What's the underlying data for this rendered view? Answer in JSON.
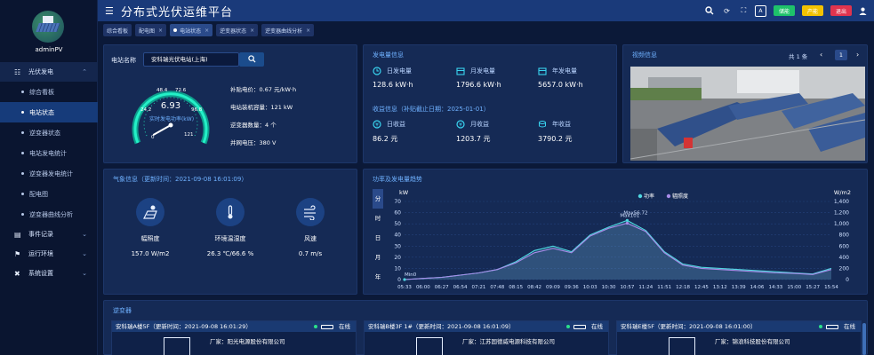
{
  "app": {
    "title": "分布式光伏运维平台",
    "username": "adminPV"
  },
  "header_buttons": [
    {
      "label": "储能",
      "color": "#1ec26a"
    },
    {
      "label": "产能",
      "color": "#f2c200"
    },
    {
      "label": "退出",
      "color": "#e0344e"
    }
  ],
  "header_icons": [
    "search-icon",
    "refresh-icon",
    "fullscreen-icon",
    "font-size-icon",
    "user-icon"
  ],
  "font_icon_text": "A",
  "tabs": [
    {
      "label": "综合看板",
      "active": false
    },
    {
      "label": "配电图",
      "active": false
    },
    {
      "label": "电站状态",
      "active": true
    },
    {
      "label": "逆变器状态",
      "active": false
    },
    {
      "label": "逆变器曲线分析",
      "active": false
    }
  ],
  "tab_close": "×",
  "nav": {
    "group_pv": "光伏发电",
    "sub": [
      "综合看板",
      "电站状态",
      "逆变器状态",
      "电站发电统计",
      "逆变器发电统计",
      "配电图",
      "逆变器曲线分析"
    ],
    "active_sub": "电站状态",
    "event_log": "事件记录",
    "operation_env": "运行环境",
    "system_settings": "系统设置"
  },
  "station": {
    "label": "电站名称",
    "selected": "安科瑞光伏电站(上海)",
    "gauge": {
      "value": 6.93,
      "max": 121,
      "ticks": [
        "0",
        "24.2",
        "48.4",
        "72.6",
        "96.8",
        "121"
      ],
      "caption": "实时发电功率(kW)"
    },
    "stats": [
      {
        "label": "补贴电价：",
        "value": "0.67 元/kW·h"
      },
      {
        "label": "电站装机容量：",
        "value": "121 kW"
      },
      {
        "label": "逆变器数量：",
        "value": "4 个"
      },
      {
        "label": "并网电压：",
        "value": "380 V"
      }
    ]
  },
  "energy": {
    "title": "发电量信息",
    "items": [
      {
        "label": "日发电量",
        "value": "128.6 kW·h"
      },
      {
        "label": "月发电量",
        "value": "1796.6 kW·h"
      },
      {
        "label": "年发电量",
        "value": "5657.0 kW·h"
      }
    ],
    "revenue_title": "收益信息（补贴截止日期：2025-01-01）",
    "revenue": [
      {
        "label": "日收益",
        "value": "86.2 元"
      },
      {
        "label": "月收益",
        "value": "1203.7 元"
      },
      {
        "label": "年收益",
        "value": "3790.2 元"
      }
    ]
  },
  "video": {
    "title": "视频信息",
    "count": "共 1 条",
    "page": "1"
  },
  "weather": {
    "title": "气象信息（更新时间：2021-09-08 16:01:09）",
    "items": [
      {
        "label": "幅照度",
        "value": "157.0 W/m2"
      },
      {
        "label": "环境温湿度",
        "value": "26.3 ℃/66.6 %"
      },
      {
        "label": "风速",
        "value": "0.7 m/s"
      }
    ]
  },
  "trend": {
    "title": "功率及发电量趋势",
    "period_tabs": [
      "分",
      "时",
      "日",
      "月",
      "年"
    ],
    "active_period": "分"
  },
  "chart_data": {
    "type": "line",
    "title": "",
    "xlabel": "",
    "ylabel": "kW",
    "y2label": "W/m2",
    "x": [
      "05:33",
      "06:00",
      "06:27",
      "06:54",
      "07:21",
      "07:48",
      "08:15",
      "08:42",
      "09:09",
      "09:36",
      "10:03",
      "10:30",
      "10:57",
      "11:24",
      "11:51",
      "12:18",
      "12:45",
      "13:12",
      "13:39",
      "14:06",
      "14:33",
      "15:00",
      "15:27",
      "15:54"
    ],
    "ylim": [
      0,
      70
    ],
    "yticks": [
      0,
      10,
      20,
      30,
      40,
      50,
      60,
      70
    ],
    "y2lim": [
      0,
      1400
    ],
    "y2ticks": [
      0,
      200,
      400,
      600,
      800,
      1000,
      1200,
      1400
    ],
    "y2tick_labels": [
      "0",
      "200",
      "400",
      "600",
      "800",
      "1,000",
      "1,200",
      "1,400"
    ],
    "legend_position": "top-center",
    "series": [
      {
        "name": "功率",
        "axis": "left",
        "color": "#4fd6e0",
        "values": [
          0,
          1,
          2,
          4,
          6,
          9,
          16,
          26,
          30,
          25,
          40,
          47,
          53,
          44,
          25,
          14,
          11,
          10,
          9,
          8,
          7,
          6,
          5,
          10
        ]
      },
      {
        "name": "辐照度",
        "axis": "right",
        "color": "#a88be8",
        "values": [
          0,
          20,
          40,
          80,
          120,
          180,
          300,
          480,
          560,
          480,
          780,
          920,
          1010,
          860,
          480,
          260,
          200,
          180,
          160,
          140,
          120,
          110,
          90,
          180
        ]
      }
    ],
    "annotations": [
      {
        "text": "Max101",
        "x": "10:57",
        "series": "功率"
      },
      {
        "text": "Max56.72",
        "x": "10:57",
        "series": "辐照度"
      },
      {
        "text": "Min0",
        "x": "05:33",
        "series": "功率"
      }
    ]
  },
  "inverter": {
    "title": "逆变器",
    "cards": [
      {
        "name": "安科瑞A楼5F（更新时间：2021-09-08 16:01:29）",
        "status": "在线",
        "maker_label": "厂家：",
        "maker": "阳光电源股份有限公司"
      },
      {
        "name": "安科瑞B楼3F 1#（更新时间：2021-09-08 16:01:09）",
        "status": "在线",
        "maker_label": "厂家：",
        "maker": "江苏固德威电源科技有限公司"
      },
      {
        "name": "安科瑞E楼5F（更新时间：2021-09-08 16:01:00）",
        "status": "在线",
        "maker_label": "厂家：",
        "maker": "锦浪科技股份有限公司"
      }
    ]
  }
}
